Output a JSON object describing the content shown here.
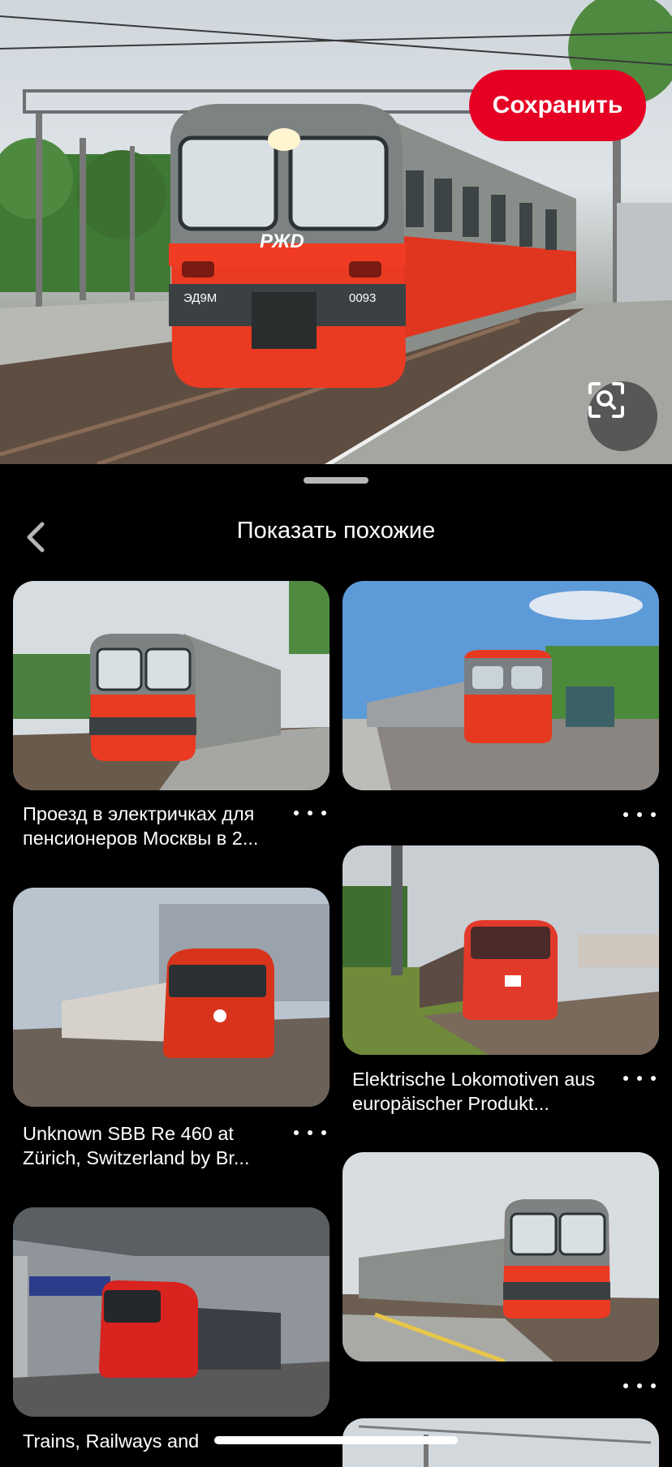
{
  "hero": {
    "save_label": "Сохранить",
    "train_logo": "РЖD",
    "train_left_number": "ЭД9М",
    "train_right_number": "0093",
    "icons": {
      "lens": "visual-search-icon"
    }
  },
  "sheet": {
    "title": "Показать похожие",
    "back_icon": "chevron-left-icon"
  },
  "pins": [
    {
      "caption": "Проезд в электричках для пенсионеров Москвы в 2...",
      "image": "red ED9M electric train at platform",
      "more_icon": "more-dots-icon"
    },
    {
      "caption": "",
      "image": "red-grey electric train under blue sky",
      "more_icon": "more-dots-icon"
    },
    {
      "caption": "Unknown SBB Re 460 at Zürich, Switzerland by Br...",
      "image": "red SBB locomotive with coaches",
      "more_icon": "more-dots-icon"
    },
    {
      "caption": "Elektrische Lokomotiven aus europäischer Produkt...",
      "image": "red DB locomotive with freight train",
      "more_icon": "more-dots-icon"
    },
    {
      "caption": "Trains, Railways and",
      "image": "red OBB locomotive in station",
      "more_icon": "more-dots-icon"
    },
    {
      "caption": "",
      "image": "red-grey electric train at platform",
      "more_icon": "more-dots-icon"
    }
  ],
  "colors": {
    "accent": "#e60023",
    "background": "#000000"
  }
}
